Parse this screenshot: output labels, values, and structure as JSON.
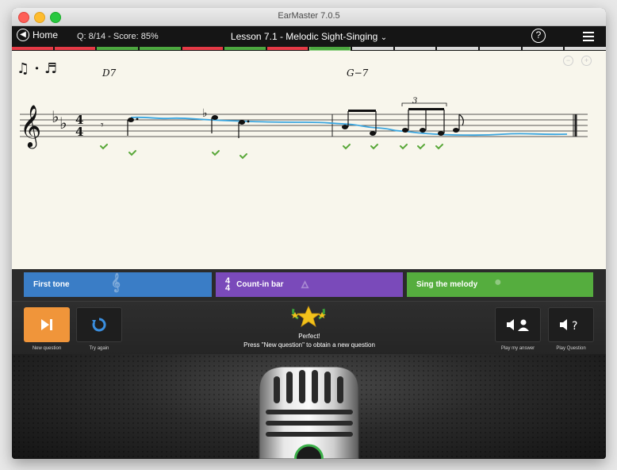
{
  "window": {
    "title": "EarMaster 7.0.5"
  },
  "nav": {
    "home_label": "Home",
    "score_text": "Q: 8/14 - Score: 85%",
    "lesson_title": "Lesson 7.1 - Melodic Sight-Singing",
    "help_label": "?"
  },
  "progress_segments": [
    "#e53a46",
    "#e53a46",
    "#4da840",
    "#4da840",
    "#e53a46",
    "#4da840",
    "#e53a46",
    "#4da840",
    "#d9d9d9",
    "#d9d9d9",
    "#d9d9d9",
    "#d9d9d9",
    "#d9d9d9",
    "#d9d9d9"
  ],
  "progress_current_index": 7,
  "sheet": {
    "rhythm_legend": "♫ · ♬",
    "chord_1": "D7",
    "chord_2": "G−7",
    "triplet_label": "3",
    "time_sig_top": "4",
    "time_sig_bottom": "4"
  },
  "steps": {
    "first_tone": "First tone",
    "count_in_top": "4",
    "count_in_bottom": "4",
    "count_in": "Count-in bar",
    "sing_melody": "Sing the melody"
  },
  "controls": {
    "new_question": "New question",
    "try_again": "Try again",
    "play_my_answer": "Play my answer",
    "play_question": "Play Question",
    "feedback_title": "Perfect!",
    "feedback_message": "Press \"New question\" to obtain a new question"
  },
  "colors": {
    "orange": "#f0953a",
    "blue": "#3a7dc6",
    "purple": "#7a4aba",
    "green": "#55ad3e",
    "pitch_trace": "#3aa6e0",
    "check": "#5aa83a"
  }
}
